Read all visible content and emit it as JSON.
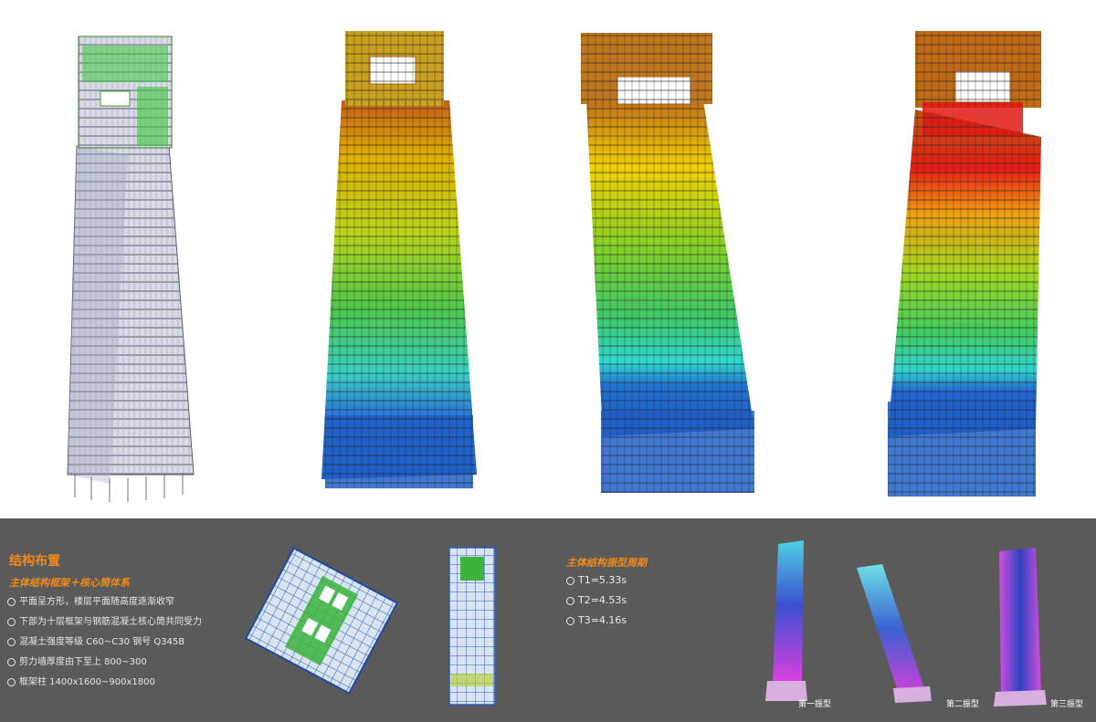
{
  "summary": {
    "title": "结构布置",
    "subtitle": "主体结构框架＋核心筒体系",
    "bullets": [
      "平面呈方形，楼层平面随高度逐渐收窄",
      "下部为十层框架与钢筋混凝土核心筒共同受力",
      "混凝土强度等级 C60~C30 钢号 Q345B",
      "剪力墙厚度由下至上 800~300",
      "框架柱 1400x1600~900x1800"
    ]
  },
  "periods": {
    "title": "主体结构振型周期",
    "items": [
      "T1=5.33s",
      "T2=4.53s",
      "T3=4.16s"
    ]
  },
  "mode_labels": [
    "第一振型",
    "第二振型",
    "第三振型"
  ],
  "colors": {
    "accent": "#f08a1c",
    "panel_bg": "#5a5a5a",
    "contour_high": "#e8201a",
    "contour_mid": "#36c43a",
    "contour_low": "#1f6fd8"
  }
}
